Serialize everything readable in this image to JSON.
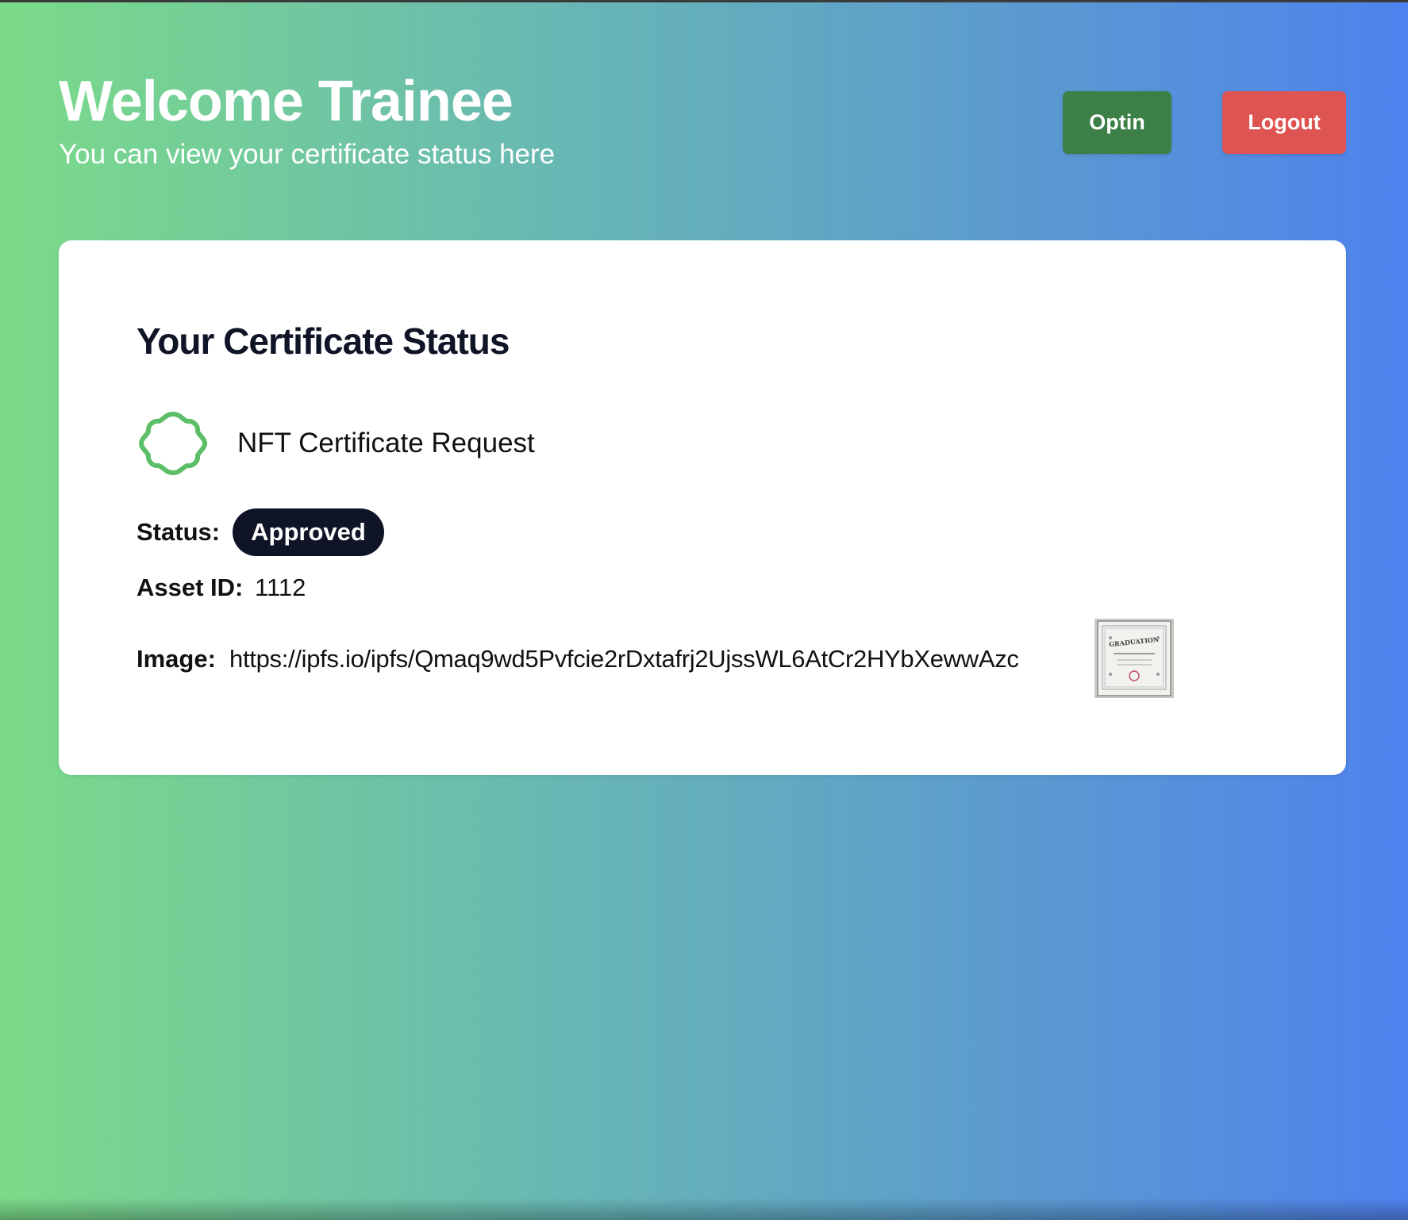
{
  "header": {
    "title": "Welcome Trainee",
    "subtitle": "You can view your certificate status here",
    "optin_label": "Optin",
    "logout_label": "Logout"
  },
  "card": {
    "title": "Your Certificate Status",
    "icon": "badge-outline-icon",
    "request_label": "NFT Certificate Request",
    "status_label": "Status:",
    "status_value": "Approved",
    "asset_label": "Asset ID:",
    "asset_value": "1112",
    "image_label": "Image:",
    "image_url": "https://ipfs.io/ipfs/Qmaq9wd5Pvfcie2rDxtafrj2UjssWL6AtCr2HYbXewwAzc",
    "thumbnail_icon": "certificate-thumbnail",
    "thumbnail_text": "GRADUATION"
  },
  "colors": {
    "gradient_start": "#7bdb88",
    "gradient_end": "#4f82ee",
    "optin_button": "#3c8048",
    "logout_button": "#de5452",
    "status_pill": "#0f1527",
    "badge_icon": "#5cbf68"
  }
}
